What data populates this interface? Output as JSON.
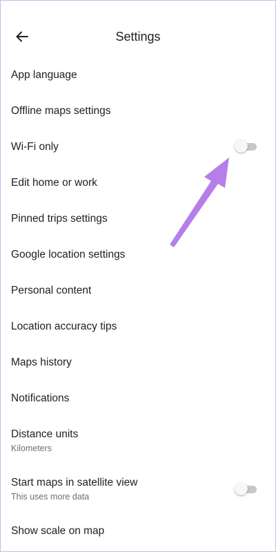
{
  "header": {
    "title": "Settings",
    "back_icon": "arrow-left-icon"
  },
  "settings": {
    "app_language": {
      "label": "App language"
    },
    "offline_maps": {
      "label": "Offline maps settings"
    },
    "wifi_only": {
      "label": "Wi-Fi only",
      "enabled": false
    },
    "edit_home_work": {
      "label": "Edit home or work"
    },
    "pinned_trips": {
      "label": "Pinned trips settings"
    },
    "google_location": {
      "label": "Google location settings"
    },
    "personal_content": {
      "label": "Personal content"
    },
    "location_accuracy": {
      "label": "Location accuracy tips"
    },
    "maps_history": {
      "label": "Maps history"
    },
    "notifications": {
      "label": "Notifications"
    },
    "distance_units": {
      "label": "Distance units",
      "value": "Kilometers"
    },
    "satellite_view": {
      "label": "Start maps in satellite view",
      "subtitle": "This uses more data",
      "enabled": false
    },
    "show_scale": {
      "label": "Show scale on map"
    }
  },
  "annotation": {
    "arrow_color": "#b57ee8"
  },
  "colors": {
    "frame": "#cdb8e8",
    "text": "#202124",
    "subtext": "#6f6f6f",
    "toggle_track": "#c7c7c7"
  }
}
